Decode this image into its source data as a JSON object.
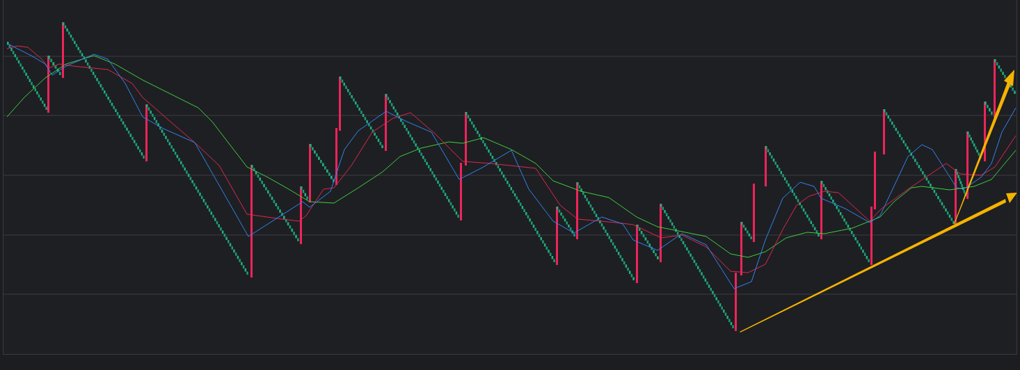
{
  "chart": {
    "kind": "renko"
  }
}
